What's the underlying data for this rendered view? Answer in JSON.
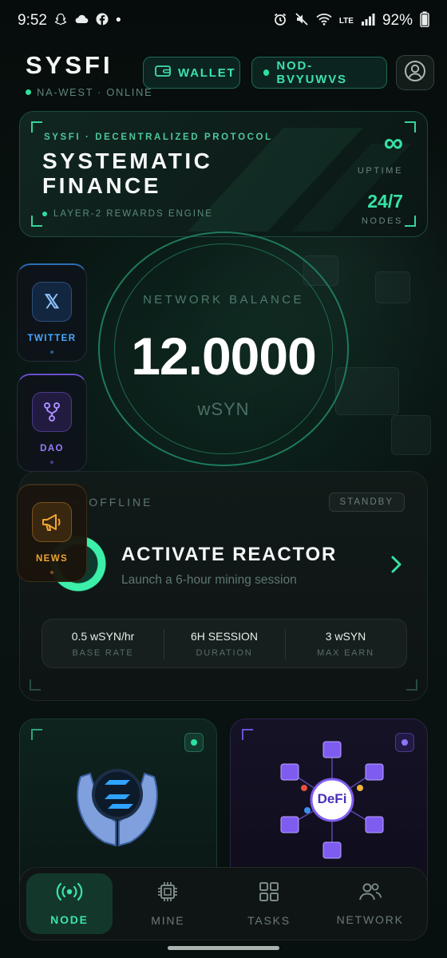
{
  "status_bar": {
    "time": "9:52",
    "bullet": "•",
    "signal_net": "LTE",
    "battery": "92%"
  },
  "header": {
    "brand": "SYSFI",
    "region": "NA-WEST · ONLINE",
    "wallet_label": "WALLET",
    "node_label": "NOD-BVYUWVS"
  },
  "hero": {
    "kicker": "SYSFI · DECENTRALIZED PROTOCOL",
    "title_line1": "SYSTEMATIC",
    "title_line2": "FINANCE",
    "footer": "LAYER-2 REWARDS ENGINE",
    "uptime_value": "∞",
    "uptime_label": "UPTIME",
    "nodes_value": "24/7",
    "nodes_label": "NODES"
  },
  "side_apps": [
    {
      "label": "TWITTER",
      "icon": "x-logo-icon",
      "glyph": "𝕏",
      "color": "#4aa8ff"
    },
    {
      "label": "DAO",
      "icon": "branch-icon",
      "color": "#9a7bff"
    },
    {
      "label": "NEWS",
      "icon": "megaphone-icon",
      "color": "#f0a531"
    }
  ],
  "balance": {
    "label": "NETWORK BALANCE",
    "value": "12.0000",
    "unit": "wSYN"
  },
  "reactor": {
    "status": "REACTOR OFFLINE",
    "status_visible": "CTOR OFFLINE",
    "badge": "STANDBY",
    "title": "ACTIVATE REACTOR",
    "subtitle": "Launch a 6-hour mining session",
    "stats": [
      {
        "value": "0.5 wSYN/hr",
        "label": "BASE RATE"
      },
      {
        "value": "6H SESSION",
        "label": "DURATION"
      },
      {
        "value": "3 wSYN",
        "label": "MAX EARN"
      }
    ]
  },
  "cards": {
    "left_icon": "hands-coin-icon",
    "right_text": "DeFi"
  },
  "nav": [
    {
      "label": "NODE",
      "icon": "broadcast-icon",
      "active": true
    },
    {
      "label": "MINE",
      "icon": "chip-icon",
      "active": false
    },
    {
      "label": "TASKS",
      "icon": "grid-icon",
      "active": false
    },
    {
      "label": "NETWORK",
      "icon": "people-icon",
      "active": false
    }
  ],
  "colors": {
    "accent": "#36e2a5",
    "bg": "#07100e",
    "twitter": "#4aa8ff",
    "dao": "#9a7bff",
    "news": "#f0a531"
  }
}
